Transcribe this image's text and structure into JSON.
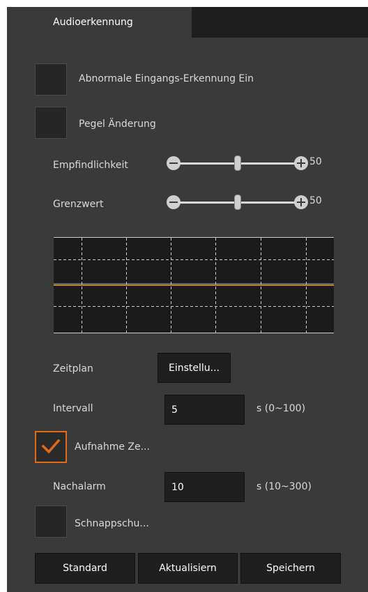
{
  "tabs": [
    {
      "label": "Audioerkennung",
      "active": true
    }
  ],
  "options": {
    "abnormal_input": {
      "label": "Abnormale Eingangs-Erkennung Ein",
      "checked": false
    },
    "level_change": {
      "label": "Pegel Änderung",
      "checked": false
    }
  },
  "sliders": {
    "sensitivity": {
      "label": "Empfindlichkeit",
      "value": "50"
    },
    "threshold": {
      "label": "Grenzwert",
      "value": "50"
    }
  },
  "schedule": {
    "label": "Zeitplan",
    "button_label": "Einstellu..."
  },
  "interval": {
    "label": "Intervall",
    "value": "5",
    "unit": "s (0~100)"
  },
  "record": {
    "label": "Aufnahme Ze...",
    "checked": true
  },
  "post_alarm": {
    "label": "Nachalarm",
    "value": "10",
    "unit": "s (10~300)"
  },
  "snapshot": {
    "label": "Schnappschu...",
    "checked": false
  },
  "footer": {
    "default_label": "Standard",
    "refresh_label": "Aktualisiern",
    "save_label": "Speichern"
  },
  "colors": {
    "accent": "#e36a18",
    "panel": "#3a3a3a",
    "graph_bg": "#1b1b1b",
    "level_line": "#f0a030"
  }
}
